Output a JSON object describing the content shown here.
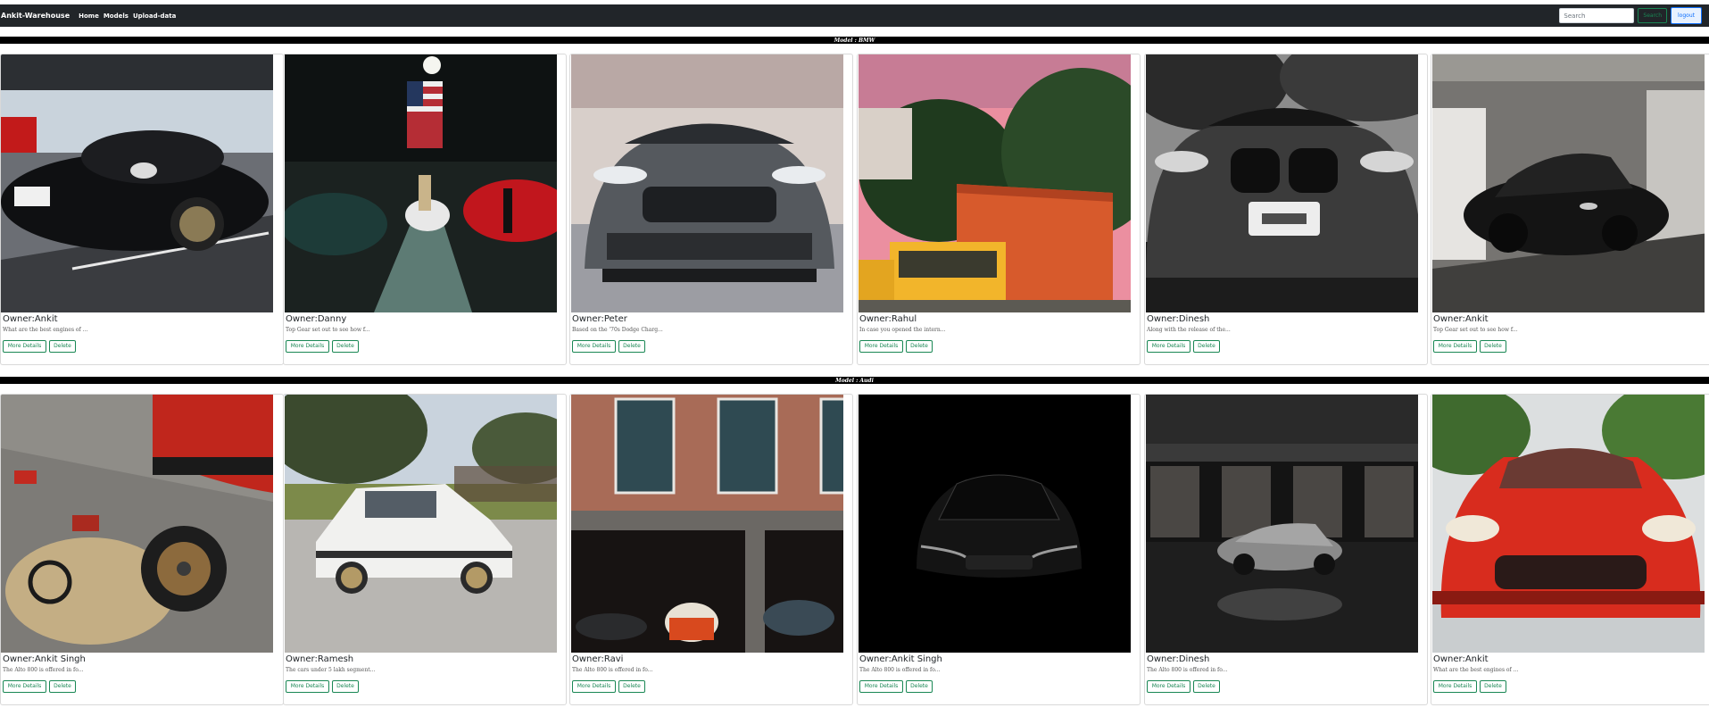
{
  "navbar": {
    "brand": "Ankit-Warehouse",
    "links": [
      "Home",
      "Models",
      "Upload-data"
    ],
    "search_placeholder": "Search",
    "search_button": "Search",
    "logout_button": "logout"
  },
  "sections": [
    {
      "title": "Model : BMW",
      "cards": [
        {
          "owner": "Owner:Ankit",
          "description": "What are the best engines of ...",
          "photo": "black porsche parked in garage",
          "more_label": "More Details",
          "delete_label": "Delete"
        },
        {
          "owner": "Owner:Danny",
          "description": "Top Gear set out to see how f...",
          "photo": "mustangs in garage with american flag",
          "more_label": "More Details",
          "delete_label": "Delete"
        },
        {
          "owner": "Owner:Peter",
          "description": "Based on the '70s Dodge Charg...",
          "photo": "grey ford focus st front view",
          "more_label": "More Details",
          "delete_label": "Delete"
        },
        {
          "owner": "Owner:Rahul",
          "description": "In case you opened the intern...",
          "photo": "yellow truck with orange container",
          "more_label": "More Details",
          "delete_label": "Delete"
        },
        {
          "owner": "Owner:Dinesh",
          "description": "Along with the release of the...",
          "photo": "black and white bmw grille",
          "more_label": "More Details",
          "delete_label": "Delete"
        },
        {
          "owner": "Owner:Ankit",
          "description": "Top Gear set out to see how f...",
          "photo": "dark roadster in parking garage",
          "more_label": "More Details",
          "delete_label": "Delete"
        }
      ]
    },
    {
      "title": "Model : Audi",
      "cards": [
        {
          "owner": "Owner:Ankit Singh",
          "description": "The Alto 800 is offered in fo...",
          "photo": "red car with wheel and tools on floor",
          "more_label": "More Details",
          "delete_label": "Delete"
        },
        {
          "owner": "Owner:Ramesh",
          "description": "The cars under 5 lakh segment...",
          "photo": "white classic bmw e30",
          "more_label": "More Details",
          "delete_label": "Delete"
        },
        {
          "owner": "Owner:Ravi",
          "description": "The Alto 800 is offered in fo...",
          "photo": "brick garage with vintage cars",
          "more_label": "More Details",
          "delete_label": "Delete"
        },
        {
          "owner": "Owner:Ankit Singh",
          "description": "The Alto 800 is offered in fo...",
          "photo": "dark car silhouette on black",
          "more_label": "More Details",
          "delete_label": "Delete"
        },
        {
          "owner": "Owner:Dinesh",
          "description": "The Alto 800 is offered in fo...",
          "photo": "silver car in front of cartier store",
          "more_label": "More Details",
          "delete_label": "Delete"
        },
        {
          "owner": "Owner:Ankit",
          "description": "What are the best engines of ...",
          "photo": "red ferrari front view",
          "more_label": "More Details",
          "delete_label": "Delete"
        }
      ]
    }
  ]
}
